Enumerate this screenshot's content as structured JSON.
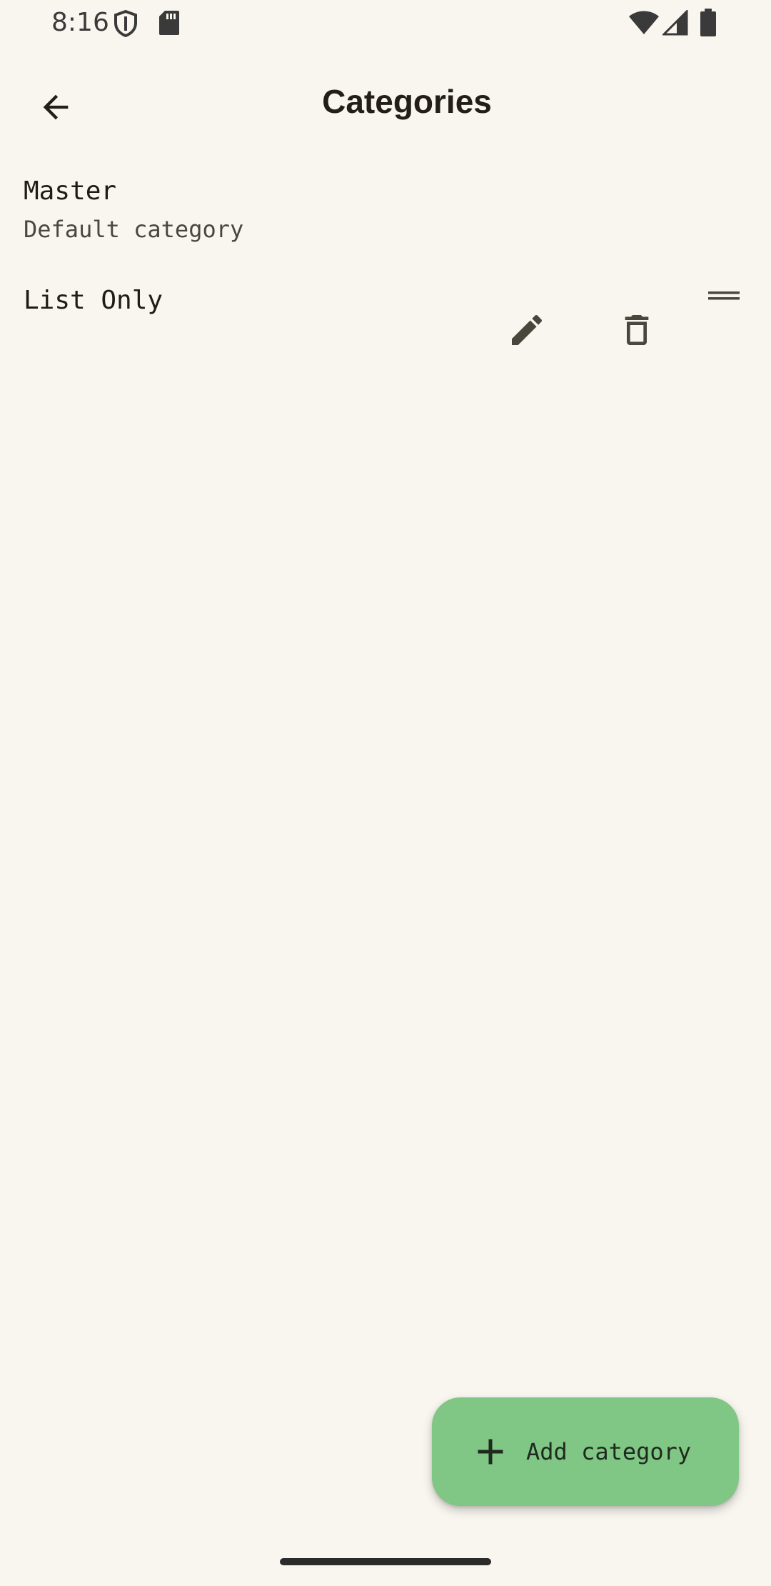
{
  "status_bar": {
    "time": "8:16",
    "icons": [
      "shield-icon",
      "sd-card-icon",
      "wifi-icon",
      "signal-icon",
      "battery-icon"
    ]
  },
  "app_bar": {
    "title": "Categories",
    "back_icon": "arrow-back-icon"
  },
  "categories": [
    {
      "title": "Master",
      "subtitle": "Default category"
    },
    {
      "title": "List Only",
      "actions": [
        "edit-icon",
        "delete-icon",
        "drag-handle-icon"
      ]
    }
  ],
  "fab": {
    "label": "Add category",
    "icon": "plus-icon",
    "color": "#80c684"
  },
  "colors": {
    "background": "#f9f6f0",
    "text": "#1f1b16",
    "icon": "#4a463c"
  }
}
